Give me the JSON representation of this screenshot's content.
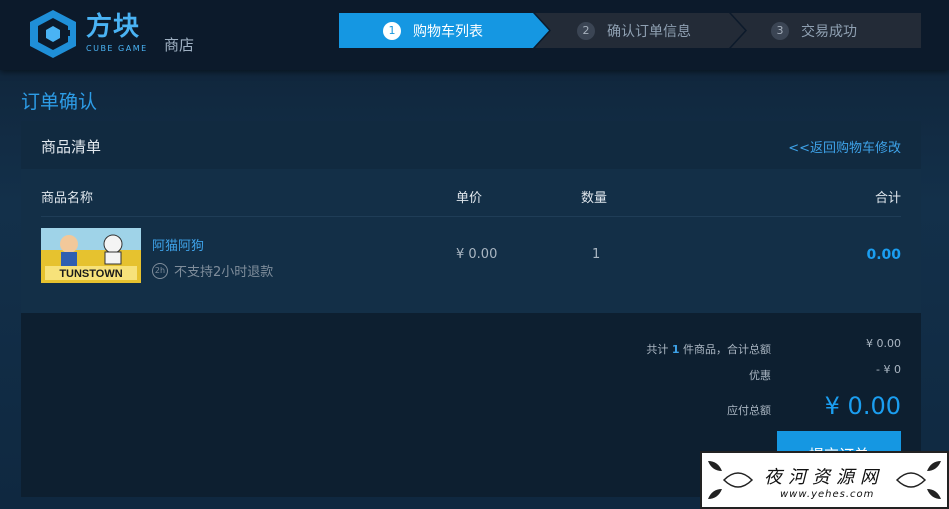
{
  "brand": {
    "title": "方块",
    "subtitle": "CUBE GAME",
    "shop": "商店",
    "color": "#4ab3f4"
  },
  "steps": [
    {
      "num": "1",
      "label": "购物车列表",
      "active": true
    },
    {
      "num": "2",
      "label": "确认订单信息",
      "active": false
    },
    {
      "num": "3",
      "label": "交易成功",
      "active": false
    }
  ],
  "page_title": "订单确认",
  "panel": {
    "title": "商品清单",
    "back_link": "<<返回购物车修改"
  },
  "columns": {
    "name": "商品名称",
    "price": "单价",
    "qty": "数量",
    "total": "合计"
  },
  "item": {
    "thumbnail_text": "TUNSTOWN",
    "name": "阿猫阿狗",
    "refund_icon": "2h",
    "refund_note": "不支持2小时退款",
    "price": "¥ 0.00",
    "qty": "1",
    "total": "0.00"
  },
  "summary": {
    "count_prefix": "共计",
    "count": "1",
    "count_suffix": "件商品，合计总额",
    "subtotal": "¥ 0.00",
    "discount_label": "优惠",
    "discount": "- ¥ 0",
    "payable_label": "应付总额",
    "payable": "¥ 0.00",
    "submit_label": "提交订单"
  },
  "watermark": {
    "text": "夜河资源网",
    "url": "www.yehes.com"
  },
  "colors": {
    "accent": "#1597e2",
    "link": "#3ea2e8",
    "header": "#0c1a2b"
  }
}
